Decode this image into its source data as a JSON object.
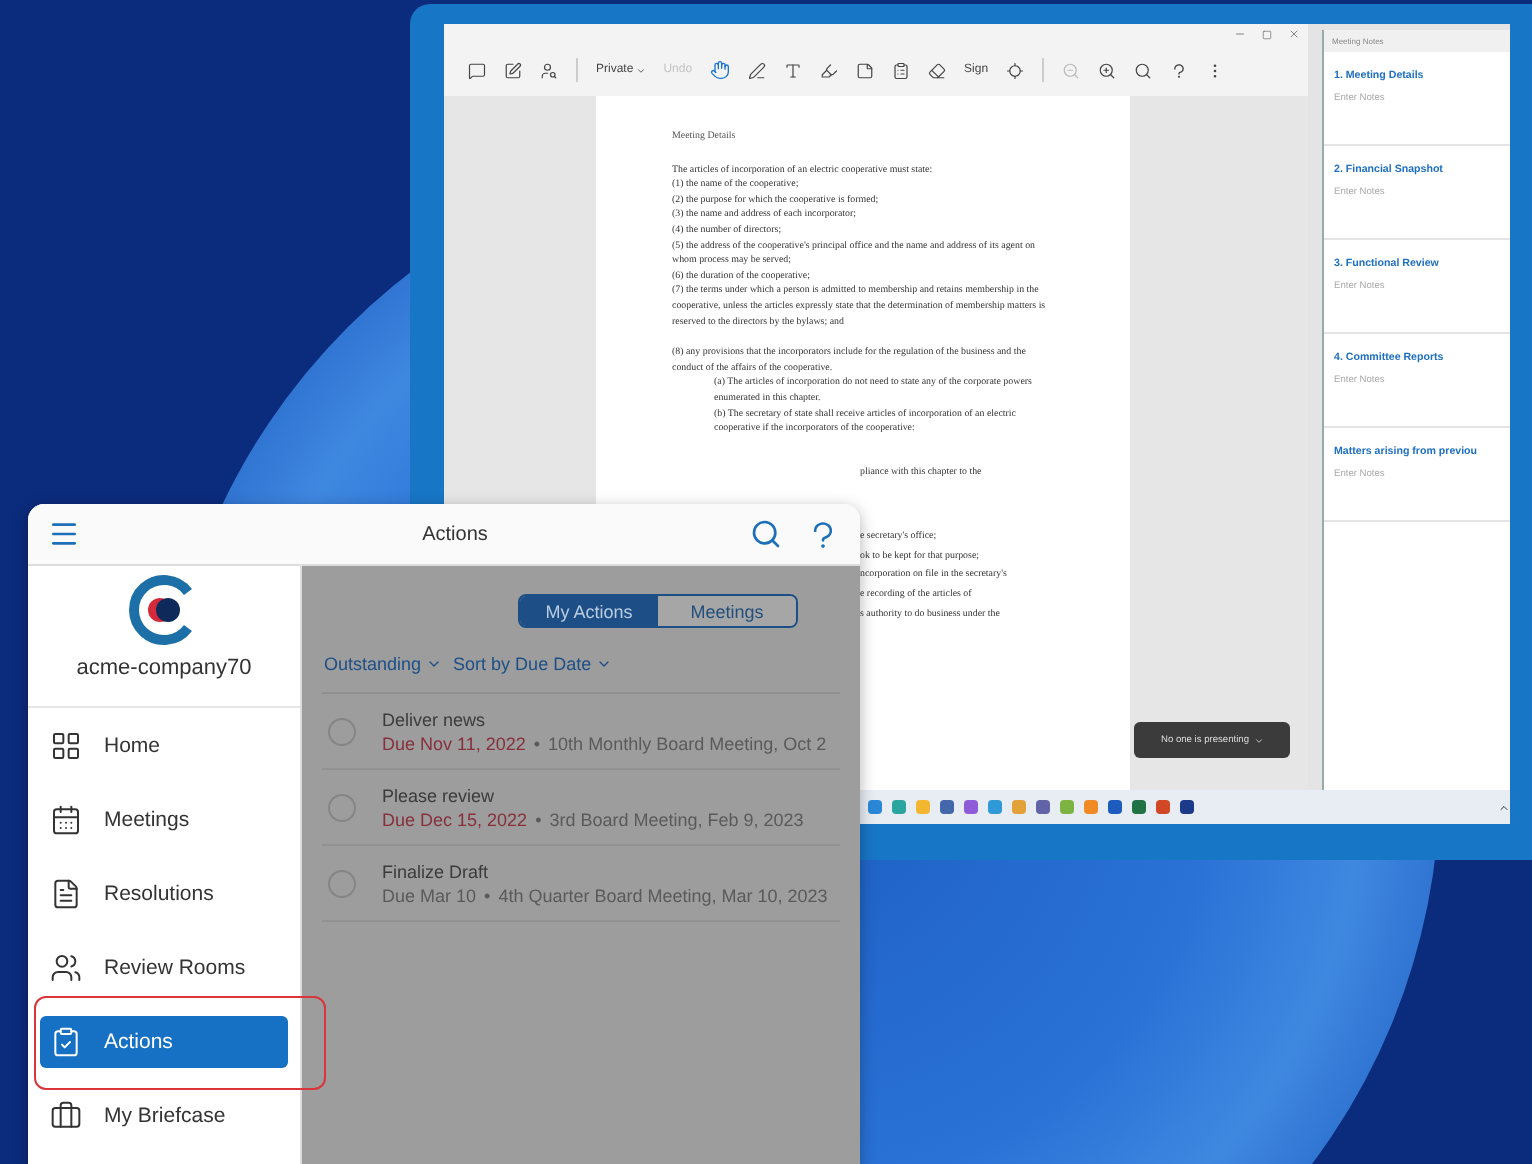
{
  "desktop_window": {
    "toolbar": [
      {
        "kind": "dropdown",
        "label": "Private",
        "disabled": false
      },
      {
        "kind": "button",
        "label": "Undo",
        "disabled": true
      },
      {
        "kind": "button",
        "label": "Sign",
        "disabled": false
      }
    ],
    "document": {
      "title": "Meeting Details",
      "groups": [
        [
          {
            "text": "The articles of incorporation of an electric cooperative must state:",
            "indented": false
          },
          {
            "text": "(1)  the name of the cooperative;",
            "indented": false
          },
          {
            "text": "(2)  the purpose for which the cooperative is formed;",
            "indented": false
          },
          {
            "text": "(3)  the name and address of each incorporator;",
            "indented": false
          },
          {
            "text": "(4)  the number of directors;",
            "indented": false
          },
          {
            "text": "(5)  the address of the cooperative's principal office and the name and address of its agent on whom process may be served;",
            "indented": false
          },
          {
            "text": "(6)  the duration of the cooperative;",
            "indented": false
          },
          {
            "text": "(7)  the terms under which a person is admitted to membership and retains membership in the cooperative, unless the articles expressly state that the determination of membership matters is reserved to the directors by the bylaws; and",
            "indented": false
          }
        ],
        [
          {
            "text": "(8)  any provisions that the incorporators include for the regulation of the business and the conduct of the affairs of the cooperative.",
            "indented": false
          },
          {
            "text": "(a)  The articles of incorporation do not need to state any of the corporate powers enumerated in this chapter.",
            "indented": true
          },
          {
            "text": "(b)  The secretary of state shall receive articles of incorporation of an electric cooperative if the incorporators of the cooperative:",
            "indented": true
          }
        ]
      ],
      "fragments": [
        [
          "pliance with this chapter to the"
        ],
        [
          "e secretary's office;",
          "ok to be kept for that purpose;",
          "ncorporation on file in the secretary's",
          "e recording of the articles of",
          "s authority to do business under the"
        ]
      ]
    },
    "presenter": {
      "label": "No one is presenting"
    },
    "notes": {
      "title": "Meeting Notes",
      "sections": [
        {
          "heading": "1.  Meeting Details",
          "placeholder": "Enter Notes"
        },
        {
          "heading": "2.  Financial Snapshot",
          "placeholder": "Enter Notes"
        },
        {
          "heading": "3.  Functional Review",
          "placeholder": "Enter Notes"
        },
        {
          "heading": "4.  Committee Reports",
          "placeholder": "Enter Notes"
        },
        {
          "heading": "Matters arising from previou",
          "placeholder": "Enter Notes"
        }
      ]
    }
  },
  "app": {
    "title": "Actions",
    "company": "acme-company70",
    "nav": [
      {
        "kind": "home",
        "label": "Home",
        "selected": false,
        "highlighted": false
      },
      {
        "kind": "meetings",
        "label": "Meetings",
        "selected": false,
        "highlighted": false
      },
      {
        "kind": "resolutions",
        "label": "Resolutions",
        "selected": false,
        "highlighted": false
      },
      {
        "kind": "rooms",
        "label": "Review Rooms",
        "selected": false,
        "highlighted": false
      },
      {
        "kind": "actions",
        "label": "Actions",
        "selected": true,
        "highlighted": true
      },
      {
        "kind": "briefcase",
        "label": "My Briefcase",
        "selected": false,
        "highlighted": false
      }
    ],
    "segments": [
      {
        "label": "My Actions",
        "selected": true
      },
      {
        "label": "Meetings",
        "selected": false
      }
    ],
    "filters": [
      "Outstanding",
      "Sort by Due Date"
    ],
    "actions": [
      {
        "title": "Deliver news",
        "due": "Due Nov 11, 2022",
        "overdue": true,
        "separator": "•",
        "meeting": "10th Monthly Board Meeting, Oct 2",
        "completed": false
      },
      {
        "title": "Please review",
        "due": "Due Dec 15, 2022",
        "overdue": true,
        "separator": "•",
        "meeting": "3rd Board Meeting, Feb 9, 2023",
        "completed": false
      },
      {
        "title": "Finalize Draft",
        "due": "Due Mar 10",
        "overdue": false,
        "separator": "•",
        "meeting": "4th Quarter Board Meeting, Mar 10, 2023",
        "completed": false
      }
    ]
  }
}
